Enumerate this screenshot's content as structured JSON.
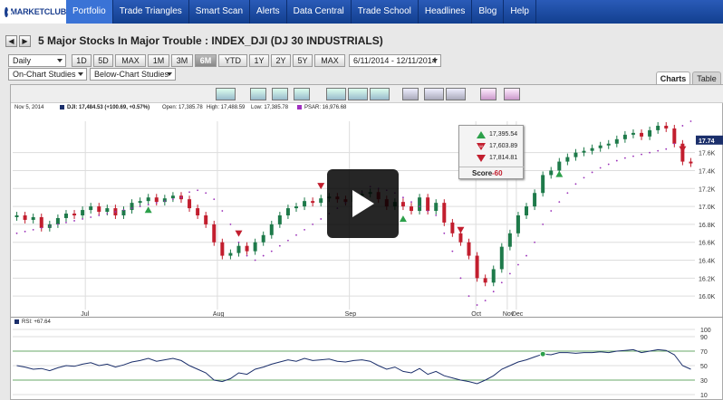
{
  "nav": {
    "logo": "MARKETCLUB",
    "items": [
      "Portfolio",
      "Trade Triangles",
      "Smart Scan",
      "Alerts",
      "Data Central",
      "Trade School",
      "Headlines",
      "Blog",
      "Help"
    ],
    "active_index": 0
  },
  "header": {
    "prev_icon": "◀",
    "next_icon": "▶",
    "title": "5 Major Stocks In Major Trouble : INDEX_DJI (DJ 30 INDUSTRIALS)"
  },
  "toolbar": {
    "interval": "Daily",
    "ranges": [
      "1D",
      "5D",
      "MAX",
      "1M",
      "3M",
      "6M",
      "YTD",
      "1Y",
      "2Y",
      "5Y",
      "MAX"
    ],
    "selected_range": "6M",
    "date_range": "6/11/2014 - 12/11/2014",
    "on_chart": "On-Chart Studies",
    "below_chart": "Below-Chart Studies",
    "tabs": [
      "Charts",
      "Table"
    ],
    "active_tab": "Charts"
  },
  "infobar": {
    "date": "Nov 5, 2014",
    "dji": "DJI: 17,484.53 (+100.69, +0.57%)",
    "open": "Open: 17,385.78",
    "high": "High: 17,488.59",
    "low": "Low: 17,385.78",
    "psar": "PSAR: 16,976.68",
    "dji_color": "#1b2f6b",
    "psar_color": "#a030c0"
  },
  "popup": {
    "rows": [
      {
        "icon": "green-up-triangle",
        "value": "17,395.54"
      },
      {
        "icon": "red-weekly-triangle",
        "value": "17,603.89"
      },
      {
        "icon": "red-down-triangle",
        "value": "17,814.81"
      }
    ],
    "score_label": "Score",
    "score_value": "-60"
  },
  "rsi_label": "RSI: +67.64",
  "chart_data": {
    "type": "candlestick",
    "price_axis": {
      "ticks": [
        "17.6K",
        "17.4K",
        "17.2K",
        "17.0K",
        "16.8K",
        "16.6K",
        "16.4K",
        "16.2K",
        "16.0K"
      ],
      "current": "17.74"
    },
    "months": [
      "Jul",
      "Aug",
      "Sep",
      "Oct",
      "Nov",
      "Dec"
    ],
    "rsi_axis": {
      "ticks": [
        "100",
        "90",
        "70",
        "50",
        "30",
        "10"
      ],
      "ylim": [
        10,
        100
      ]
    },
    "close": [
      16900,
      16850,
      16880,
      16760,
      16800,
      16870,
      16920,
      16900,
      16960,
      17000,
      16940,
      16980,
      16900,
      16960,
      17040,
      17060,
      17100,
      17050,
      17090,
      17120,
      17080,
      16980,
      16900,
      16800,
      16600,
      16450,
      16480,
      16560,
      16500,
      16600,
      16680,
      16800,
      16900,
      16980,
      17000,
      17060,
      17040,
      17090,
      17110,
      17080,
      17050,
      17120,
      17140,
      17160,
      17080,
      17000,
      17050,
      17000,
      16950,
      17100,
      16950,
      17040,
      16820,
      16700,
      16600,
      16450,
      16200,
      16150,
      16300,
      16550,
      16700,
      16900,
      17000,
      17150,
      17350,
      17400,
      17500,
      17550,
      17600,
      17620,
      17650,
      17680,
      17700,
      17750,
      17800,
      17820,
      17780,
      17850,
      17900,
      17870,
      17700,
      17500,
      17480
    ],
    "psar": [
      16700,
      16720,
      16740,
      16760,
      16780,
      16800,
      16820,
      16840,
      16860,
      16880,
      16900,
      16920,
      16940,
      16960,
      16980,
      17000,
      17020,
      17040,
      17060,
      17080,
      17100,
      17160,
      17180,
      17150,
      17080,
      16950,
      16800,
      16600,
      16450,
      16400,
      16450,
      16500,
      16560,
      16620,
      16680,
      16740,
      16800,
      16860,
      16920,
      16980,
      17040,
      17100,
      17160,
      17220,
      17200,
      17180,
      17150,
      17100,
      17050,
      17000,
      16950,
      16900,
      16700,
      16500,
      16200,
      16000,
      15900,
      15950,
      16050,
      16150,
      16250,
      16350,
      16450,
      16600,
      16800,
      16950,
      17050,
      17150,
      17250,
      17320,
      17380,
      17430,
      17470,
      17510,
      17540,
      17560,
      17580,
      17600,
      17620,
      17640,
      17700,
      17900,
      17950
    ],
    "rsi": [
      50,
      48,
      45,
      46,
      43,
      47,
      50,
      49,
      52,
      54,
      50,
      52,
      48,
      51,
      55,
      57,
      60,
      56,
      58,
      60,
      57,
      50,
      45,
      40,
      30,
      28,
      32,
      40,
      38,
      45,
      48,
      52,
      55,
      58,
      56,
      60,
      57,
      58,
      59,
      56,
      55,
      57,
      58,
      56,
      50,
      45,
      48,
      42,
      40,
      46,
      38,
      42,
      36,
      33,
      30,
      28,
      25,
      30,
      36,
      45,
      50,
      55,
      58,
      62,
      66,
      65,
      68,
      68,
      67,
      68,
      68,
      69,
      68,
      70,
      71,
      72,
      68,
      70,
      72,
      71,
      65,
      50,
      45
    ]
  },
  "colors": {
    "up": "#1e7a4a",
    "down": "#c21e2e",
    "psar": "#9a2fb8",
    "grid": "#dddddd",
    "nav_active": "#3a73d6"
  }
}
